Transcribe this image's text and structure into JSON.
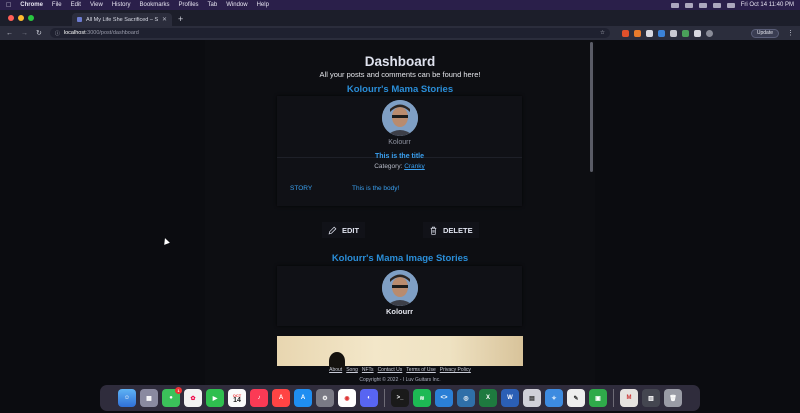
{
  "menubar": {
    "app": "Chrome",
    "items": [
      "File",
      "Edit",
      "View",
      "History",
      "Bookmarks",
      "Profiles",
      "Tab",
      "Window",
      "Help"
    ],
    "clock": "Fri Oct 14  11:40 PM"
  },
  "browser": {
    "tab_title": "All My Life She Sacrificed – Sh",
    "url_host": "localhost",
    "url_path": ":3000/post/dashboard",
    "update_label": "Update"
  },
  "page": {
    "title": "Dashboard",
    "subtitle": "All your posts and comments can be found here!",
    "section1": {
      "heading": "Kolourr's Mama Stories",
      "author": "Kolourr",
      "post_title": "This is the title",
      "category_label": "Category:",
      "category_value": "Cranky",
      "story_label": "STORY",
      "story_body": "This is the body!",
      "edit_label": "EDIT",
      "delete_label": "DELETE"
    },
    "section2": {
      "heading": "Kolourr's Mama Image Stories",
      "author": "Kolourr"
    },
    "footer": {
      "links": [
        "About",
        "Song",
        "NFTs",
        "Contact Us",
        "Terms of Use",
        "Privacy Policy"
      ],
      "copyright": "Copyright © 2022 - I Luv Guitars Inc."
    }
  },
  "dock": {
    "calendar_month": "OCT",
    "calendar_day": "14",
    "messages_badge": "1"
  },
  "colors": {
    "accent_blue": "#2a8ed8",
    "background": "#0b0c10"
  }
}
